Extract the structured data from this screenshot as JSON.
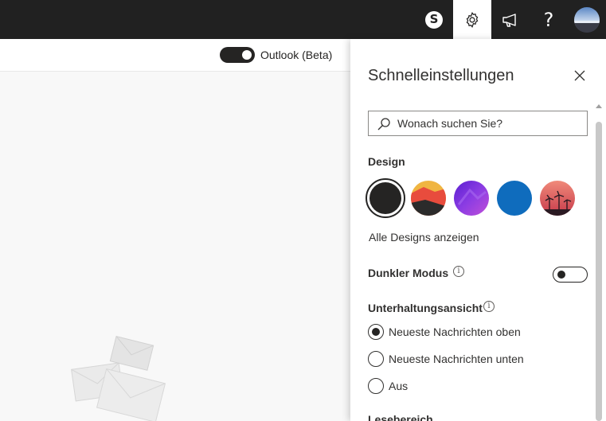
{
  "topbar": {
    "skype_letter": "S",
    "help_glyph": "?",
    "icons": [
      "skype-icon",
      "gear-icon",
      "megaphone-icon",
      "help-icon",
      "avatar"
    ]
  },
  "subbar": {
    "beta_label": "Outlook (Beta)",
    "beta_enabled": true
  },
  "panel": {
    "title": "Schnelleinstellungen",
    "search_placeholder": "Wonach suchen Sie?",
    "design_heading": "Design",
    "themes": [
      {
        "name": "dark",
        "selected": true,
        "color": "#252423"
      },
      {
        "name": "sunset-mountain",
        "selected": false,
        "color": "#e84c3d"
      },
      {
        "name": "purple",
        "selected": false,
        "color": "#7b2fd6"
      },
      {
        "name": "blue",
        "selected": false,
        "color": "#0f6cbd"
      },
      {
        "name": "palms",
        "selected": false,
        "color": "#d9534f"
      }
    ],
    "all_designs": "Alle Designs anzeigen",
    "dark_mode_label": "Dunkler Modus",
    "dark_mode_enabled": false,
    "conversation_heading": "Unterhaltungsansicht",
    "conversation_options": [
      {
        "label": "Neueste Nachrichten oben",
        "checked": true
      },
      {
        "label": "Neueste Nachrichten unten",
        "checked": false
      },
      {
        "label": "Aus",
        "checked": false
      }
    ],
    "reading_pane_heading": "Lesebereich"
  },
  "colors": {
    "topbar_bg": "#212121",
    "accent_dark": "#252423",
    "panel_bg": "#ffffff"
  }
}
